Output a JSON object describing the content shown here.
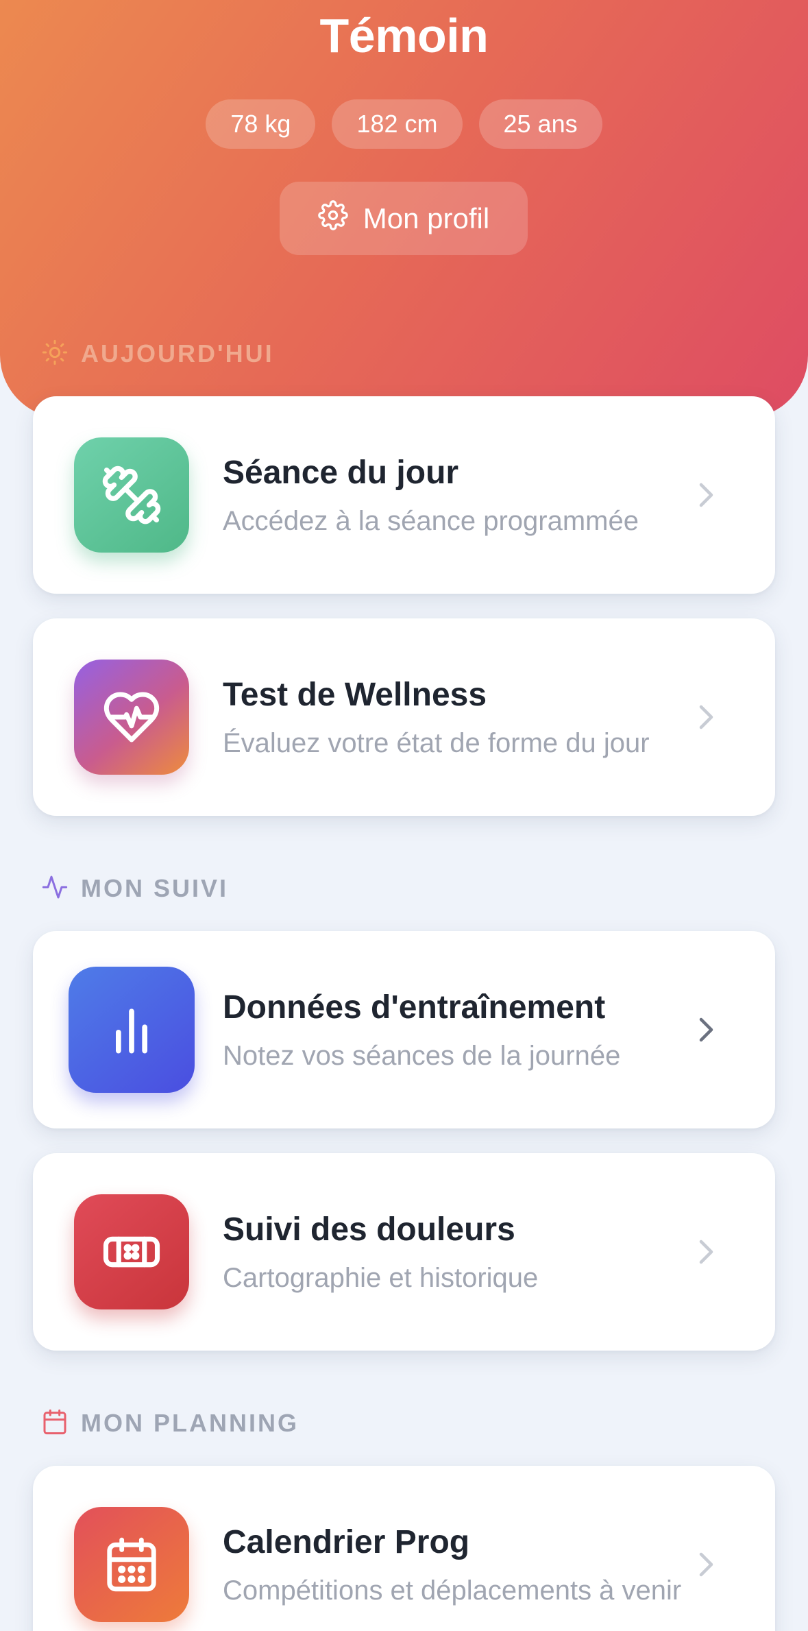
{
  "header": {
    "title": "Témoin",
    "stats": {
      "weight": "78 kg",
      "height": "182 cm",
      "age": "25 ans"
    },
    "profile_button": "Mon profil",
    "gradient": [
      "#ec8950",
      "#de4c63"
    ]
  },
  "sections": {
    "today": {
      "label": "AUJOURD'HUI",
      "icon": "sun-icon",
      "accent": "#f5a25a"
    },
    "tracking": {
      "label": "MON SUIVI",
      "icon": "activity-icon",
      "accent": "#8b6fe0"
    },
    "planning": {
      "label": "MON PLANNING",
      "icon": "calendar-icon",
      "accent": "#e8606d"
    }
  },
  "cards": {
    "session": {
      "title": "Séance du jour",
      "subtitle": "Accédez à la séance programmée",
      "icon": "dumbbell-icon"
    },
    "wellness": {
      "title": "Test de Wellness",
      "subtitle": "Évaluez votre état de forme du jour",
      "icon": "heart-pulse-icon"
    },
    "training": {
      "title": "Données d'entraînement",
      "subtitle": "Notez vos séances de la journée",
      "icon": "bar-chart-icon"
    },
    "pain": {
      "title": "Suivi des douleurs",
      "subtitle": "Cartographie et historique",
      "icon": "bandage-icon"
    },
    "calendar": {
      "title": "Calendrier Prog",
      "subtitle": "Compétitions et déplacements à venir",
      "icon": "calendar-icon"
    }
  }
}
